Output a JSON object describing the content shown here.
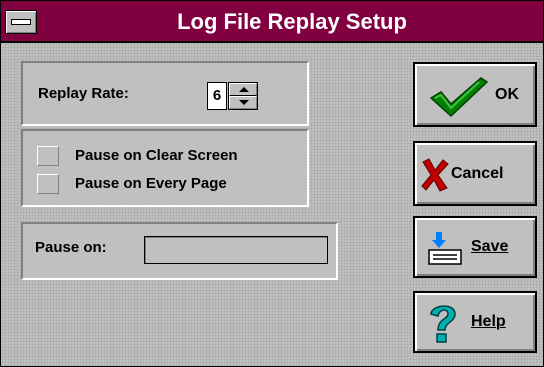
{
  "window": {
    "title": "Log File Replay Setup",
    "title_bar_color": "#800040",
    "system_menu_icon": "system-menu-icon"
  },
  "replay_rate": {
    "label": "Replay Rate:",
    "value": "6"
  },
  "options": {
    "pause_on_clear_screen": {
      "label": "Pause on Clear Screen",
      "checked": false
    },
    "pause_on_every_page": {
      "label": "Pause on Every Page",
      "checked": false
    }
  },
  "pause_on": {
    "label": "Pause on:",
    "value": ""
  },
  "buttons": {
    "ok": {
      "label": "OK",
      "icon": "checkmark-icon",
      "icon_color": "#008000"
    },
    "cancel": {
      "label": "Cancel",
      "icon": "x-mark-icon",
      "icon_color": "#c00000"
    },
    "save": {
      "label": "Save",
      "accelerator": "S",
      "icon": "save-icon"
    },
    "help": {
      "label": "Help",
      "accelerator": "H",
      "icon": "question-mark-icon",
      "icon_color": "#00a0a0"
    }
  }
}
